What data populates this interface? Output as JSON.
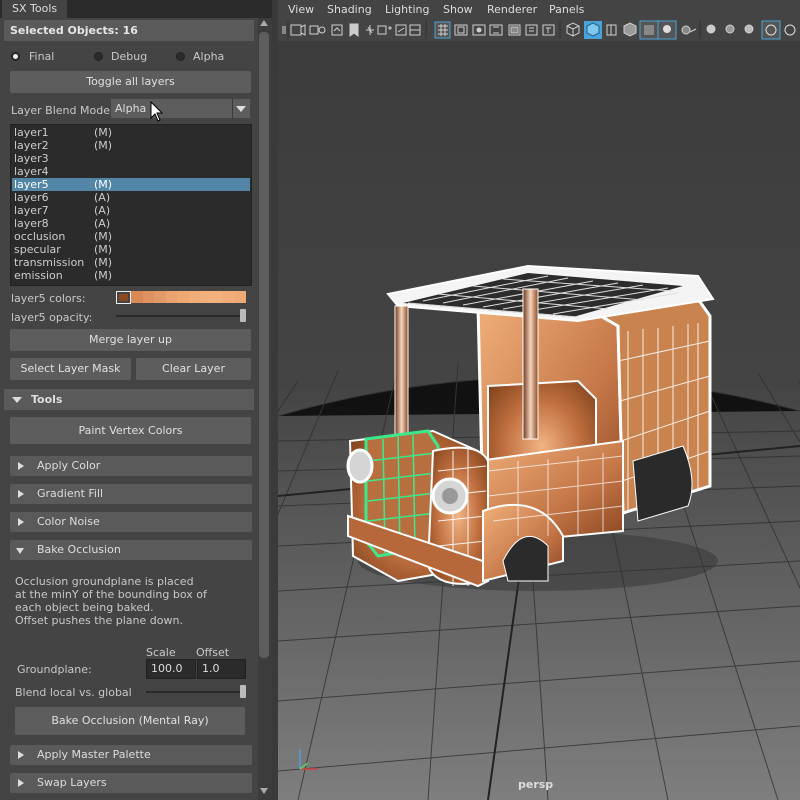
{
  "panel": {
    "tab_title": "SX Tools",
    "selected_objects": "Selected Objects: 16",
    "modes": [
      {
        "label": "Final",
        "selected": true
      },
      {
        "label": "Debug",
        "selected": false
      },
      {
        "label": "Alpha",
        "selected": false
      }
    ],
    "toggle_layers": "Toggle all layers",
    "blend_mode_label": "Layer Blend Mode:",
    "blend_mode_value": "Alpha",
    "layers": [
      {
        "name": "layer1",
        "mode": "(M)",
        "selected": false
      },
      {
        "name": "layer2",
        "mode": "(M)",
        "selected": false
      },
      {
        "name": "layer3",
        "mode": "",
        "selected": false
      },
      {
        "name": "layer4",
        "mode": "",
        "selected": false
      },
      {
        "name": "layer5",
        "mode": "(M)",
        "selected": true
      },
      {
        "name": "layer6",
        "mode": "(A)",
        "selected": false
      },
      {
        "name": "layer7",
        "mode": "(A)",
        "selected": false
      },
      {
        "name": "layer8",
        "mode": "(A)",
        "selected": false
      },
      {
        "name": "occlusion",
        "mode": "(M)",
        "selected": false
      },
      {
        "name": "specular",
        "mode": "(M)",
        "selected": false
      },
      {
        "name": "transmission",
        "mode": "(M)",
        "selected": false
      },
      {
        "name": "emission",
        "mode": "(M)",
        "selected": false
      }
    ],
    "colors_label": "layer5 colors:",
    "palette": [
      "#d78a55",
      "#dd9260",
      "#e39a69",
      "#e9a270",
      "#eda874",
      "#f0ad78",
      "#f2b07c",
      "#f3b17e",
      "#f0ad7a",
      "#eda976"
    ],
    "opacity_label": "layer5 opacity:",
    "opacity_value": 1.0,
    "merge_up": "Merge layer up",
    "select_mask": "Select Layer Mask",
    "clear_layer": "Clear Layer",
    "tools_header": "Tools",
    "paint_vertex": "Paint Vertex Colors",
    "sections": {
      "apply_color": "Apply Color",
      "gradient_fill": "Gradient Fill",
      "color_noise": "Color Noise",
      "bake_occlusion": "Bake Occlusion",
      "apply_master": "Apply Master Palette",
      "swap_layers": "Swap Layers"
    },
    "occlusion_desc": [
      "Occlusion groundplane is placed",
      "at the minY of the bounding box of",
      "each object being baked.",
      "Offset pushes the plane down."
    ],
    "scale_label": "Scale",
    "offset_label": "Offset",
    "groundplane_label": "Groundplane:",
    "scale_value": "100.0",
    "offset_value": "1.0",
    "blend_label": "Blend local vs. global",
    "blend_value": 1.0,
    "bake_button": "Bake Occlusion (Mental Ray)"
  },
  "viewport": {
    "menu": [
      "View",
      "Shading",
      "Lighting",
      "Show",
      "Renderer",
      "Panels"
    ],
    "camera": "persp",
    "accent": "#4aa3d8",
    "selection_color": "#3ee88a",
    "wire_color": "#ffffff"
  }
}
